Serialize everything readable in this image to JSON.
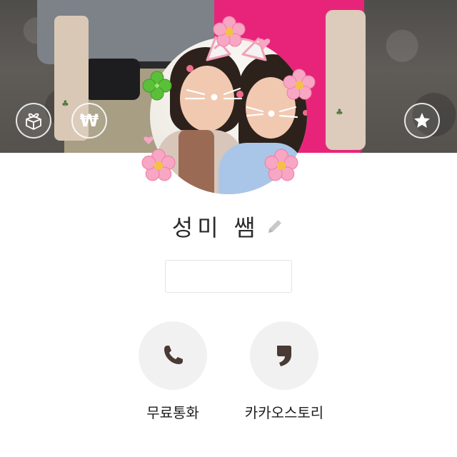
{
  "profile": {
    "name": "성미  쌤",
    "status_message": ""
  },
  "cover": {
    "gift_button": {
      "icon": "gift-box-icon"
    },
    "pay_button": {
      "icon": "won-icon",
      "glyph": "₩"
    },
    "favorite_button": {
      "icon": "star-icon"
    }
  },
  "actions": [
    {
      "label": "무료통화",
      "icon": "phone-icon"
    },
    {
      "label": "카카오스토리",
      "icon": "kakaostory-icon"
    }
  ],
  "colors": {
    "cover_pink": "#e8247a",
    "action_bg": "#f1f1f1",
    "action_icon": "#4a3a34",
    "text": "#1e1e1e"
  }
}
